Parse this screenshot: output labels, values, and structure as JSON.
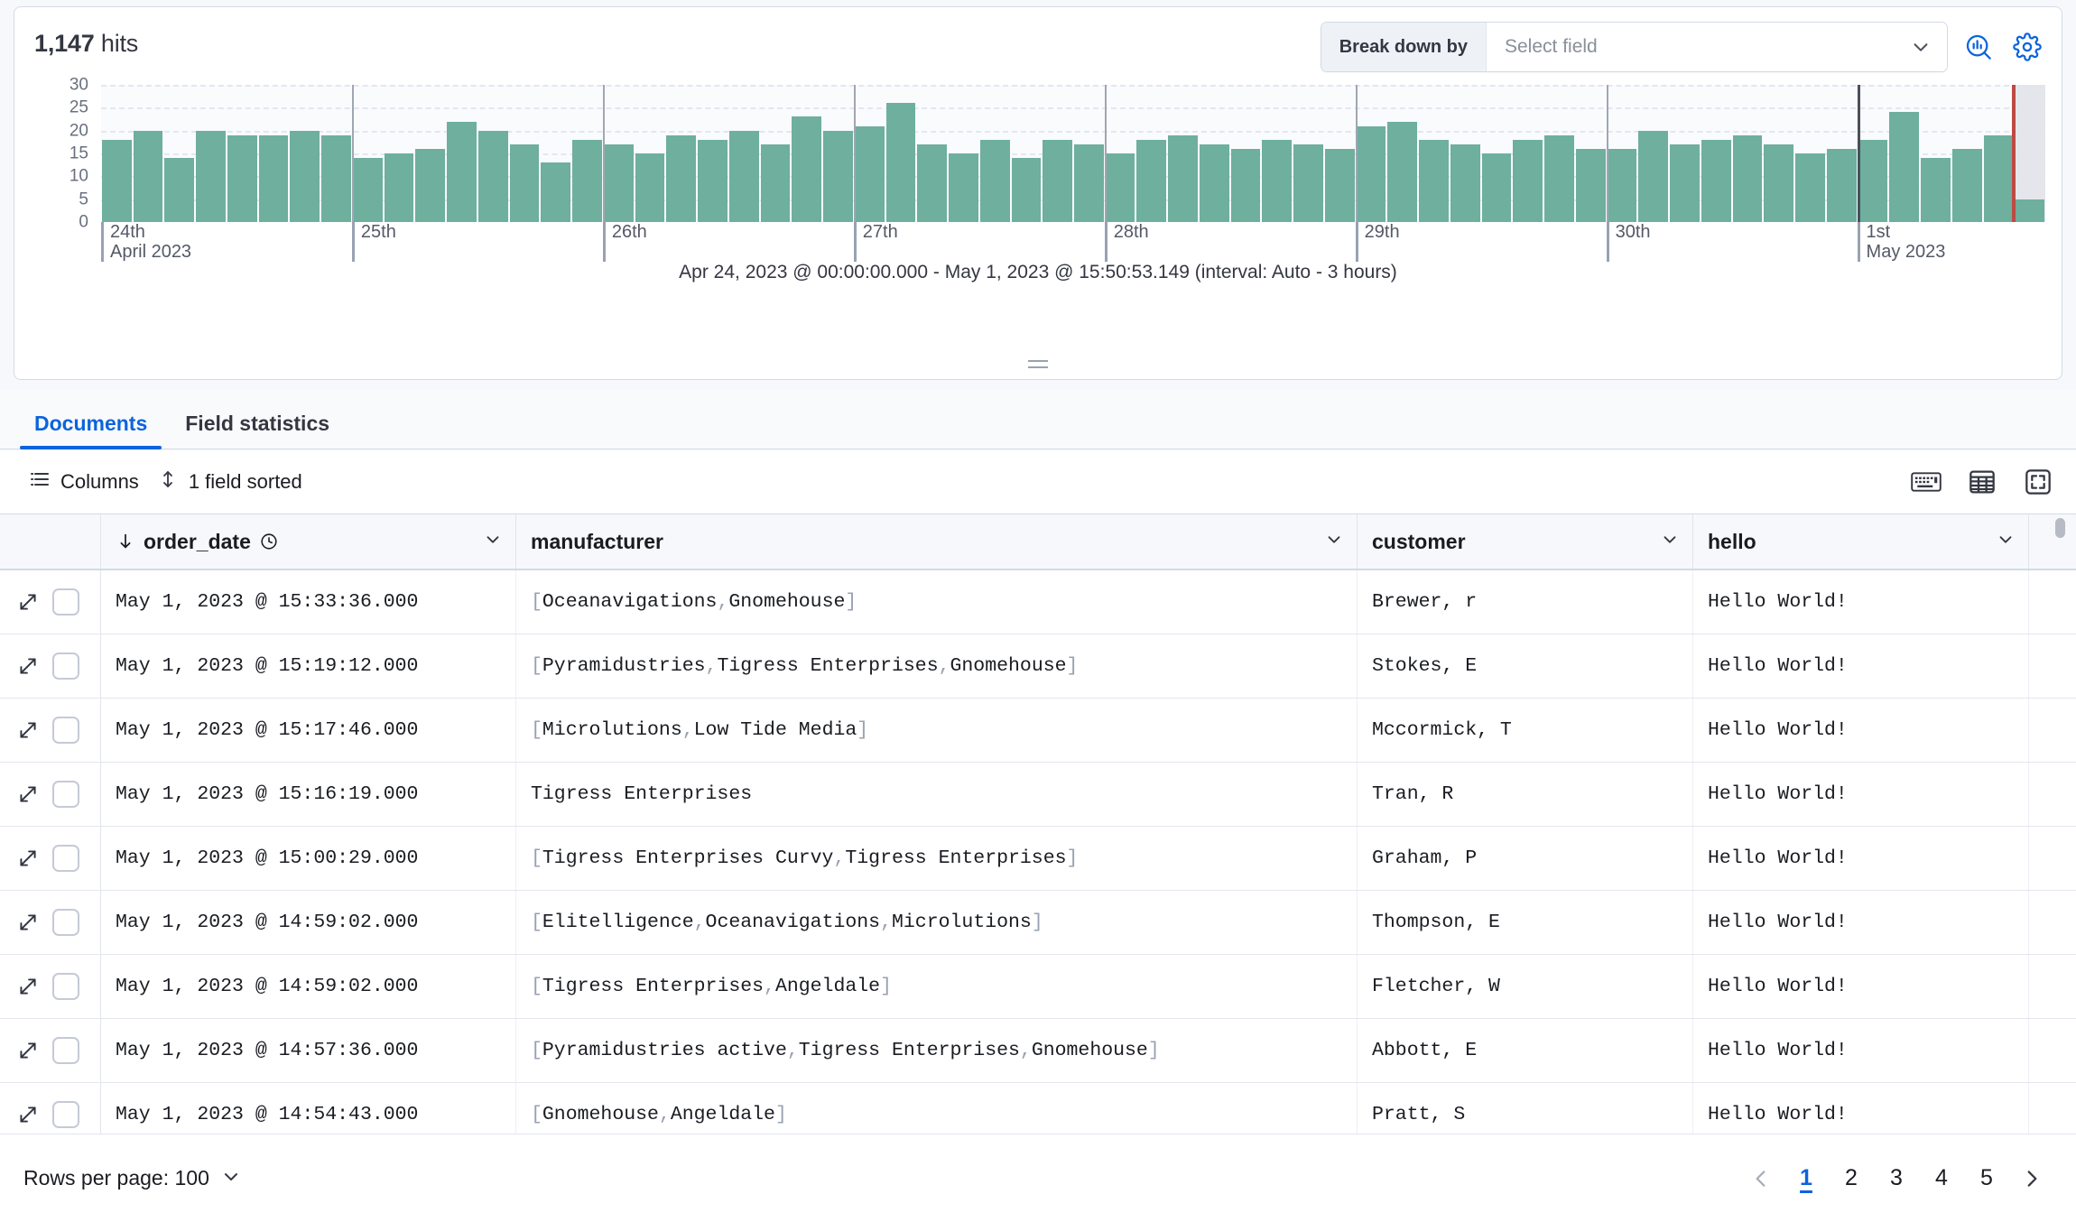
{
  "header": {
    "hits_count": "1,147",
    "hits_unit": "hits",
    "breakdown_label": "Break down by",
    "breakdown_placeholder": "Select field",
    "chevron_icon": "chevron-down-icon",
    "lens_icon": "lens-visualization-icon",
    "gear_icon": "gear-icon"
  },
  "chart_data": {
    "type": "bar",
    "title": "",
    "subtitle": "Apr 24, 2023 @ 00:00:00.000 - May 1, 2023 @ 15:50:53.149 (interval: Auto - 3 hours)",
    "xlabel": "",
    "ylabel": "",
    "ylim": [
      0,
      30
    ],
    "yticks": [
      0,
      5,
      10,
      15,
      20,
      25,
      30
    ],
    "grid": true,
    "legend": "none",
    "bar_color": "#6EAF9E",
    "partial_bucket_color": "#E3E5EB",
    "annotation_line_color": "#BD4A44",
    "interval": "3 hours",
    "x_day_ticks": [
      {
        "label": "24th",
        "sublabel": "April 2023",
        "index": 0
      },
      {
        "label": "25th",
        "sublabel": "",
        "index": 8
      },
      {
        "label": "26th",
        "sublabel": "",
        "index": 16
      },
      {
        "label": "27th",
        "sublabel": "",
        "index": 24
      },
      {
        "label": "28th",
        "sublabel": "",
        "index": 32
      },
      {
        "label": "29th",
        "sublabel": "",
        "index": 40
      },
      {
        "label": "30th",
        "sublabel": "",
        "index": 48
      },
      {
        "label": "1st",
        "sublabel": "May 2023",
        "index": 56
      }
    ],
    "values": [
      18,
      20,
      14,
      20,
      19,
      19,
      20,
      19,
      14,
      15,
      16,
      22,
      20,
      17,
      13,
      18,
      17,
      15,
      19,
      18,
      20,
      17,
      23,
      20,
      21,
      26,
      17,
      15,
      18,
      14,
      18,
      17,
      15,
      18,
      19,
      17,
      16,
      18,
      17,
      16,
      21,
      22,
      18,
      17,
      15,
      18,
      19,
      16,
      16,
      20,
      17,
      18,
      19,
      17,
      15,
      16,
      18,
      24,
      14,
      16,
      19,
      5
    ],
    "partial_last_bucket": true
  },
  "resizer": {
    "grip_icon": "resize-grip-icon"
  },
  "tabs": [
    {
      "label": "Documents",
      "active": true
    },
    {
      "label": "Field statistics",
      "active": false
    }
  ],
  "grid_toolbar": {
    "columns_label": "Columns",
    "columns_icon": "list-icon",
    "sort_label": "1 field sorted",
    "sort_icon": "sort-updown-icon",
    "keyboard_icon": "keyboard-shortcuts-icon",
    "density_icon": "table-density-icon",
    "fullscreen_icon": "fullscreen-icon"
  },
  "table": {
    "columns": [
      {
        "id": "order_date",
        "label": "order_date",
        "sorted": true,
        "sort_icon": "sort-descending-arrow-icon",
        "type_icon": "clock-icon",
        "menu_icon": "chevron-down-icon"
      },
      {
        "id": "manufacturer",
        "label": "manufacturer",
        "menu_icon": "chevron-down-icon"
      },
      {
        "id": "customer",
        "label": "customer",
        "menu_icon": "chevron-down-icon"
      },
      {
        "id": "hello",
        "label": "hello",
        "menu_icon": "chevron-down-icon"
      }
    ],
    "control_icons": {
      "expand": "expand-arrows-icon",
      "checkbox": "row-select-checkbox"
    },
    "rows": [
      {
        "order_date": "May 1, 2023 @ 15:33:36.000",
        "manufacturer": [
          "Oceanavigations",
          "Gnomehouse"
        ],
        "manufacturer_is_array": true,
        "customer": "Brewer, r",
        "hello": "Hello World!"
      },
      {
        "order_date": "May 1, 2023 @ 15:19:12.000",
        "manufacturer": [
          "Pyramidustries",
          "Tigress Enterprises",
          "Gnomehouse"
        ],
        "manufacturer_is_array": true,
        "customer": "Stokes, E",
        "hello": "Hello World!"
      },
      {
        "order_date": "May 1, 2023 @ 15:17:46.000",
        "manufacturer": [
          "Microlutions",
          "Low Tide Media"
        ],
        "manufacturer_is_array": true,
        "customer": "Mccormick, T",
        "hello": "Hello World!"
      },
      {
        "order_date": "May 1, 2023 @ 15:16:19.000",
        "manufacturer": [
          "Tigress Enterprises"
        ],
        "manufacturer_is_array": false,
        "customer": "Tran, R",
        "hello": "Hello World!"
      },
      {
        "order_date": "May 1, 2023 @ 15:00:29.000",
        "manufacturer": [
          "Tigress Enterprises Curvy",
          "Tigress Enterprises"
        ],
        "manufacturer_is_array": true,
        "customer": "Graham, P",
        "hello": "Hello World!"
      },
      {
        "order_date": "May 1, 2023 @ 14:59:02.000",
        "manufacturer": [
          "Elitelligence",
          "Oceanavigations",
          "Microlutions"
        ],
        "manufacturer_is_array": true,
        "customer": "Thompson, E",
        "hello": "Hello World!"
      },
      {
        "order_date": "May 1, 2023 @ 14:59:02.000",
        "manufacturer": [
          "Tigress Enterprises",
          "Angeldale"
        ],
        "manufacturer_is_array": true,
        "customer": "Fletcher, W",
        "hello": "Hello World!"
      },
      {
        "order_date": "May 1, 2023 @ 14:57:36.000",
        "manufacturer": [
          "Pyramidustries active",
          "Tigress Enterprises",
          "Gnomehouse"
        ],
        "manufacturer_is_array": true,
        "customer": "Abbott, E",
        "hello": "Hello World!"
      },
      {
        "order_date": "May 1, 2023 @ 14:54:43.000",
        "manufacturer": [
          "Gnomehouse",
          "Angeldale"
        ],
        "manufacturer_is_array": true,
        "customer": "Pratt, S",
        "hello": "Hello World!"
      }
    ]
  },
  "footer": {
    "rows_per_page_label": "Rows per page: 100",
    "rows_per_page_chevron": "chevron-down-icon",
    "prev_icon": "chevron-left-icon",
    "next_icon": "chevron-right-icon",
    "pages": [
      "1",
      "2",
      "3",
      "4",
      "5"
    ],
    "active_page": "1"
  },
  "colors": {
    "accent": "#0B64DD",
    "bar": "#6EAF9E",
    "annotation": "#BD4A44",
    "text": "#1A1C21",
    "muted": "#69707D",
    "border": "#D3DAE6"
  }
}
